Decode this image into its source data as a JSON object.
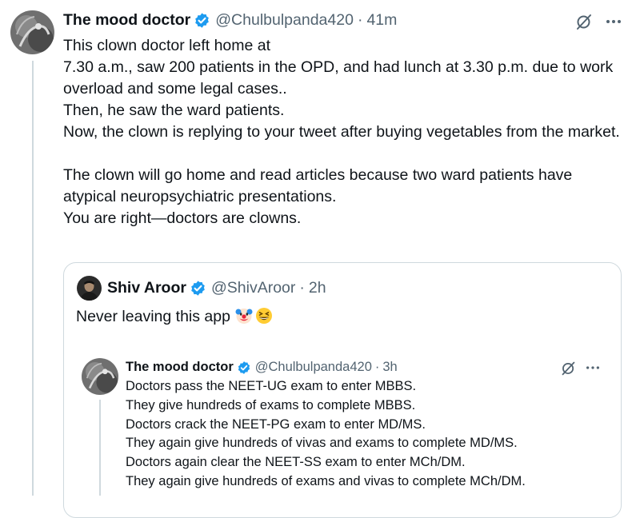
{
  "main_post": {
    "author_name": "The mood doctor",
    "handle": "@Chulbulpanda420",
    "separator": "·",
    "time": "41m",
    "text": "This clown doctor left home at\n7.30  a.m., saw 200 patients in the OPD, and had lunch at 3.30  p.m. due to work overload and some legal cases..\nThen, he saw the ward patients.\nNow, the clown is replying to your tweet after buying vegetables from the market.\n\nThe clown will go home and read articles because two ward patients have atypical neuropsychiatric presentations.\nYou are right—doctors are clowns.",
    "more_label": "···"
  },
  "quoted_post": {
    "author_name": "Shiv Aroor",
    "handle": "@ShivAroor",
    "separator": "·",
    "time": "2h",
    "text": "Never leaving this app",
    "emojis": [
      "clown-face-emoji",
      "grinning-squinting-face-emoji"
    ]
  },
  "nested_post": {
    "author_name": "The mood doctor",
    "handle": "@Chulbulpanda420",
    "separator": "·",
    "time": "3h",
    "text": "Doctors pass the NEET-UG exam to enter MBBS.\nThey give hundreds of exams to complete MBBS.\nDoctors crack the NEET-PG exam to enter MD/MS.\nThey again give hundreds of vivas and exams to complete MD/MS.\nDoctors again clear the NEET-SS exam to enter MCh/DM.\nThey again give hundreds of exams and vivas to complete MCh/DM.",
    "more_label": "···"
  },
  "colors": {
    "text": "#0f1419",
    "secondary": "#536471",
    "verified": "#1d9bf0",
    "border": "#cfd9de"
  },
  "icons": {
    "verified": "verified-badge-icon",
    "grok": "grok-icon",
    "more": "more-icon"
  }
}
